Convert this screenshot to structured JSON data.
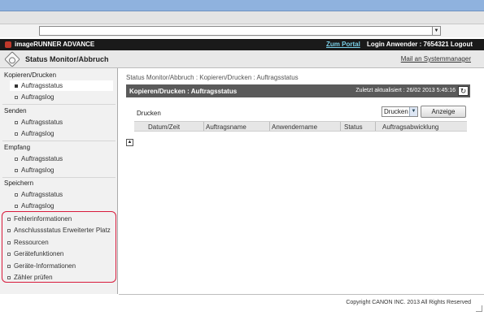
{
  "app": {
    "brand": "imageRUNNER ADVANCE",
    "portal_link": "Zum Portal",
    "login_text": "Login Anwender : 7654321 Logout"
  },
  "header": {
    "title": "Status Monitor/Abbruch",
    "mail_link": "Mail an Systemmanager"
  },
  "sidebar": {
    "groups": [
      {
        "label": "Kopieren/Drucken",
        "items": [
          "Auftragsstatus",
          "Auftragslog"
        ]
      },
      {
        "label": "Senden",
        "items": [
          "Auftragsstatus",
          "Auftragslog"
        ]
      },
      {
        "label": "Empfang",
        "items": [
          "Auftragsstatus",
          "Auftragslog"
        ]
      },
      {
        "label": "Speichern",
        "items": [
          "Auftragsstatus",
          "Auftragslog"
        ]
      }
    ],
    "extra_items": [
      "Fehlerinformationen",
      "Anschlussstatus Erweiterter Platz",
      "Ressourcen",
      "Gerätefunktionen",
      "Geräte-Informationen",
      "Zähler prüfen"
    ]
  },
  "main": {
    "breadcrumb": "Status Monitor/Abbruch : Kopieren/Drucken : Auftragsstatus",
    "panel_title": "Kopieren/Drucken : Auftragsstatus",
    "updated": "Zuletzt aktualisiert : 26/02 2013 5:45:16",
    "section_label": "Drucken",
    "select_value": "Drucken",
    "display_button": "Anzeige",
    "columns": [
      "Datum/Zeit",
      "Auftragsname",
      "Anwendername",
      "Status",
      "Auftragsabwicklung"
    ]
  },
  "footer": {
    "copyright": "Copyright CANON INC. 2013 All Rights Reserved"
  },
  "colors": {
    "highlight_border": "#d81a3b",
    "panel_header": "#5a5a5a",
    "app_bar": "#1a1a1a",
    "portal_link": "#7ad0e8"
  }
}
